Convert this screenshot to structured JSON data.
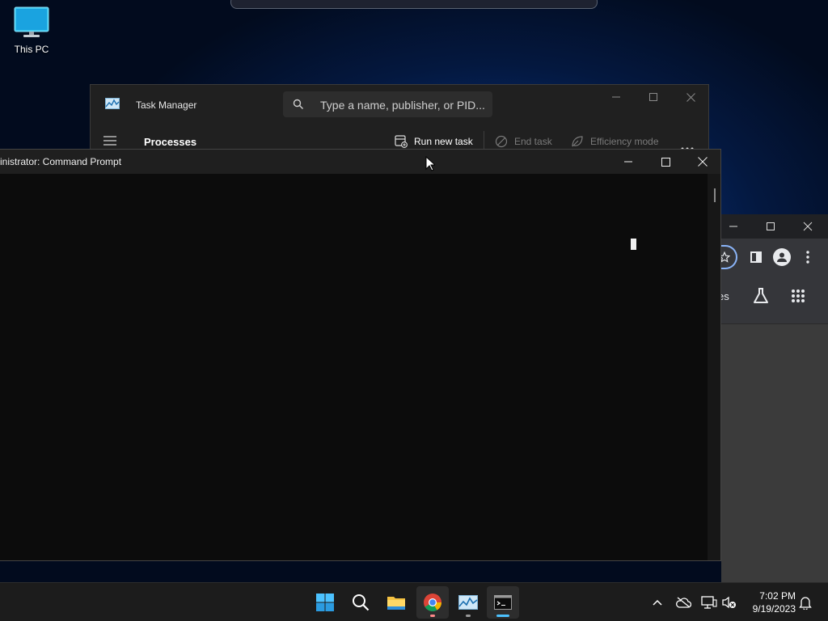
{
  "desktop": {
    "icons": [
      {
        "label": "This PC",
        "icon": "monitor-icon"
      }
    ]
  },
  "task_manager": {
    "title": "Task Manager",
    "search_placeholder": "Type a name, publisher, or PID...",
    "page_title": "Processes",
    "commands": {
      "run_new_task": "Run new task",
      "end_task": "End task",
      "efficiency_mode": "Efficiency mode"
    }
  },
  "command_prompt": {
    "title": "inistrator: Command Prompt"
  },
  "chrome": {
    "bookmark_fragment": "es"
  },
  "taskbar": {
    "apps": [
      "windows-start",
      "search",
      "file-explorer",
      "chrome",
      "task-manager",
      "command-prompt"
    ],
    "time": "7:02 PM",
    "date": "9/19/2023"
  },
  "colors": {
    "accent": "#4cc2ff",
    "terminal_bg": "#0c0c0c",
    "window_bg": "#202020"
  }
}
